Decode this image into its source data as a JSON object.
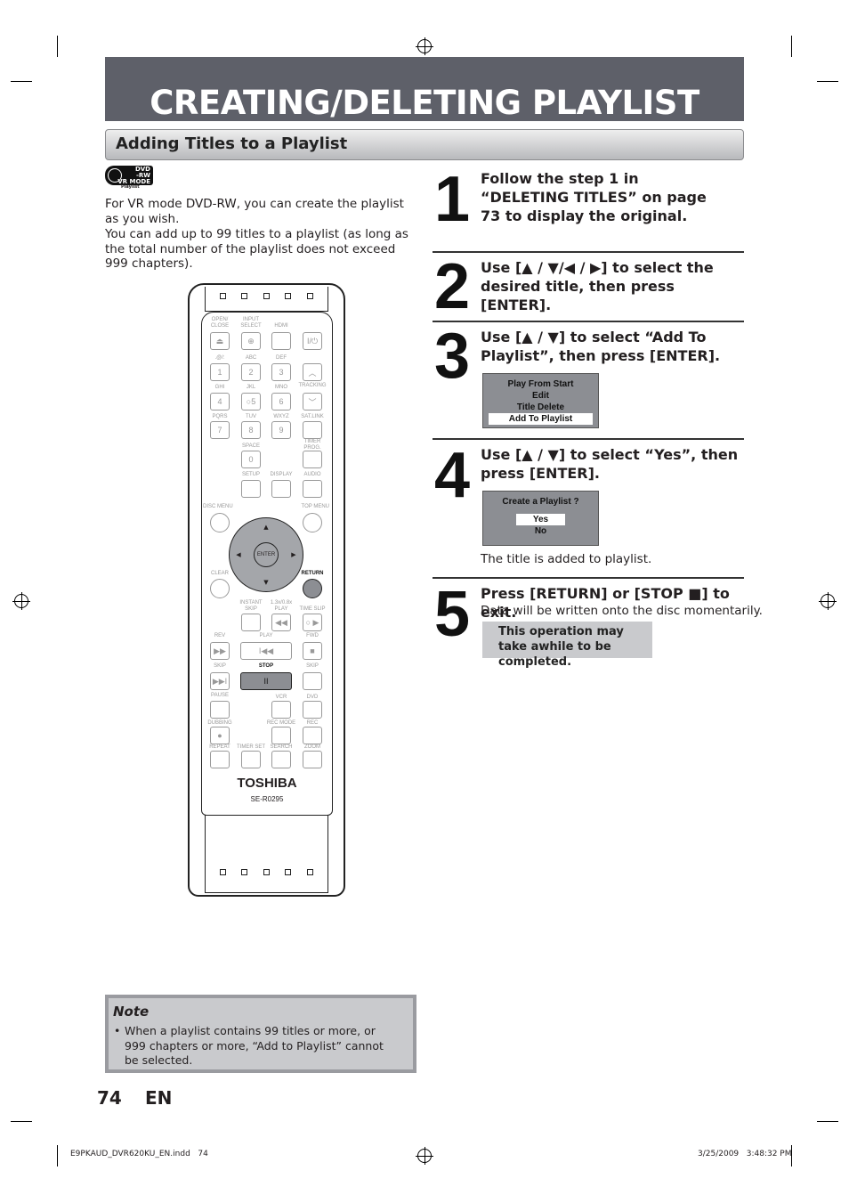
{
  "header": {
    "title": "CREATING/DELETING PLAYLIST",
    "subtitle": "Adding Titles to a Playlist"
  },
  "logo": {
    "text": "DVD -RW VR MODE",
    "caption": "Playlist"
  },
  "intro": [
    "For VR mode DVD-RW, you can create the playlist as you wish.",
    "You can add up to 99 titles to a playlist (as long as the total number of the playlist does not exceed 999 chapters)."
  ],
  "steps": [
    {
      "num": "1",
      "text": "Follow the step 1 in “DELETING TITLES” on page 73 to display the original."
    },
    {
      "num": "2",
      "text": "Use [▲ / ▼/◀ / ▶] to select the desired title, then press [ENTER]."
    },
    {
      "num": "3",
      "text": "Use [▲ / ▼] to select “Add To Playlist”, then press [ENTER].",
      "menu": [
        "Play From Start",
        "Edit",
        "Title Delete",
        "Add To Playlist"
      ],
      "selected": 3
    },
    {
      "num": "4",
      "text": "Use [▲ / ▼] to select “Yes”, then press [ENTER].",
      "dialog": {
        "question": "Create a Playlist ?",
        "options": [
          "Yes",
          "No"
        ],
        "selected": 0
      },
      "after": "The title is added to playlist."
    },
    {
      "num": "5",
      "text": "Press [RETURN] or [STOP ■] to exit.",
      "sub": "Data will be written onto the disc momentarily.",
      "callout": "This operation may take awhile to be completed."
    }
  ],
  "note": {
    "title": "Note",
    "items": [
      "When a playlist contains 99 titles or more, or 999 chapters or more, “Add to Playlist” cannot be selected."
    ]
  },
  "footer": {
    "page": "74",
    "lang": "EN",
    "file": "E9PKAUD_DVR620KU_EN.indd   74",
    "date": "3/25/2009   3:48:32 PM"
  },
  "remote": {
    "brand": "TOSHIBA",
    "model": "SE-R0295",
    "labels": [
      "OPEN/\nCLOSE",
      "INPUT\nSELECT",
      "HDMI",
      ".@/:",
      "ABC",
      "DEF",
      "GHI",
      "JKL",
      "MNO",
      "TRACKING",
      "PQRS",
      "TUV",
      "WXYZ",
      "SAT.LINK",
      "SPACE",
      "TIMER\nPROG.",
      "SETUP",
      "DISPLAY",
      "AUDIO",
      "DISC MENU",
      "TOP MENU",
      "CLEAR",
      "RETURN",
      "INSTANT\nSKIP",
      "1.3x/0.8x\nPLAY",
      "TIME SLIP",
      "REV",
      "PLAY",
      "FWD",
      "SKIP",
      "STOP",
      "SKIP",
      "PAUSE",
      "VCR",
      "DVD",
      "DUBBING",
      "REC MODE",
      "REC",
      "REPEAT",
      "TIMER SET",
      "SEARCH",
      "ZOOM"
    ],
    "keys": [
      "⏏",
      "⊕",
      "",
      "I/⏻",
      "1",
      "2",
      "3",
      "︿",
      "4",
      "○5",
      "6",
      "﹀",
      "7",
      "8",
      "9",
      "",
      "0",
      "",
      "",
      "ↀ",
      "",
      "",
      "",
      "",
      "",
      "",
      "◀◀",
      "○      ▶",
      "▶▶",
      "I◀◀",
      "■",
      "▶▶I",
      "II",
      "",
      "",
      "",
      "",
      "●",
      "",
      "",
      "",
      ""
    ],
    "dpad": {
      "enter": "ENTER",
      "up": "▲",
      "down": "▼",
      "left": "◀",
      "right": "▶"
    }
  }
}
